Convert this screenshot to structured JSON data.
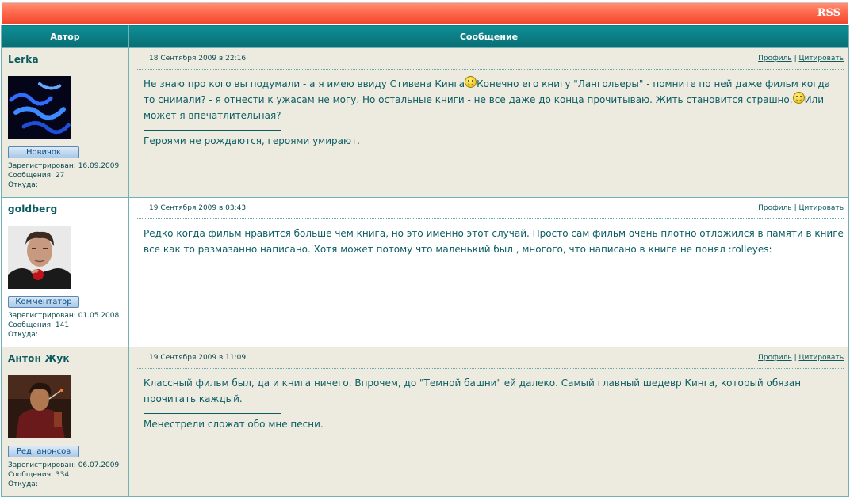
{
  "header": {
    "rss_label": "RSS"
  },
  "table": {
    "col_author": "Автор",
    "col_message": "Сообщение"
  },
  "labels": {
    "profile": "Профиль",
    "quote": "Цитировать",
    "separator": "|",
    "registered": "Зарегистрирован:",
    "messages": "Сообщения:",
    "from": "Откуда:"
  },
  "posts": [
    {
      "username": "Lerka",
      "rank": "Новичок",
      "registered": "16.09.2009",
      "messages": "27",
      "from": "",
      "date": "18 Сентября 2009 в 22:16",
      "text_a": "Не знаю про кого вы подумали - а я имею ввиду Стивена Кинга",
      "text_b": "Конечно его книгу \"Лангольеры\" - помните по ней даже фильм когда то снимали? - я отнести к ужасам не могу. Но остальные книги - не все даже до конца прочитываю. Жить становится страшно.",
      "text_c": "Или может я впечатлительная?",
      "signature": "Героями не рождаются, героями умирают."
    },
    {
      "username": "goldberg",
      "rank": "Комментатор",
      "registered": "01.05.2008",
      "messages": "141",
      "from": "",
      "date": "19 Сентября 2009 в 03:43",
      "text": "Редко когда фильм нравится больше чем книга, но это именно этот случай. Просто сам фильм очень плотно отложился в памяти в книге все как то размазанно написано. Хотя может потому что маленький был , многого, что написано в книге не понял :rolleyes:",
      "signature": ""
    },
    {
      "username": "Антон Жук",
      "rank": "Ред. анонсов",
      "registered": "06.07.2009",
      "messages": "334",
      "from": "",
      "date": "19 Сентября 2009 в 11:09",
      "text": "Классный фильм был, да и книга ничего. Впрочем, до \"Темной башни\" ей далеко. Самый главный шедевр Кинга, который обязан прочитать каждый.",
      "signature": "Менестрели сложат обо мне песни."
    }
  ],
  "icons": {
    "smiley": "smiley-icon"
  }
}
